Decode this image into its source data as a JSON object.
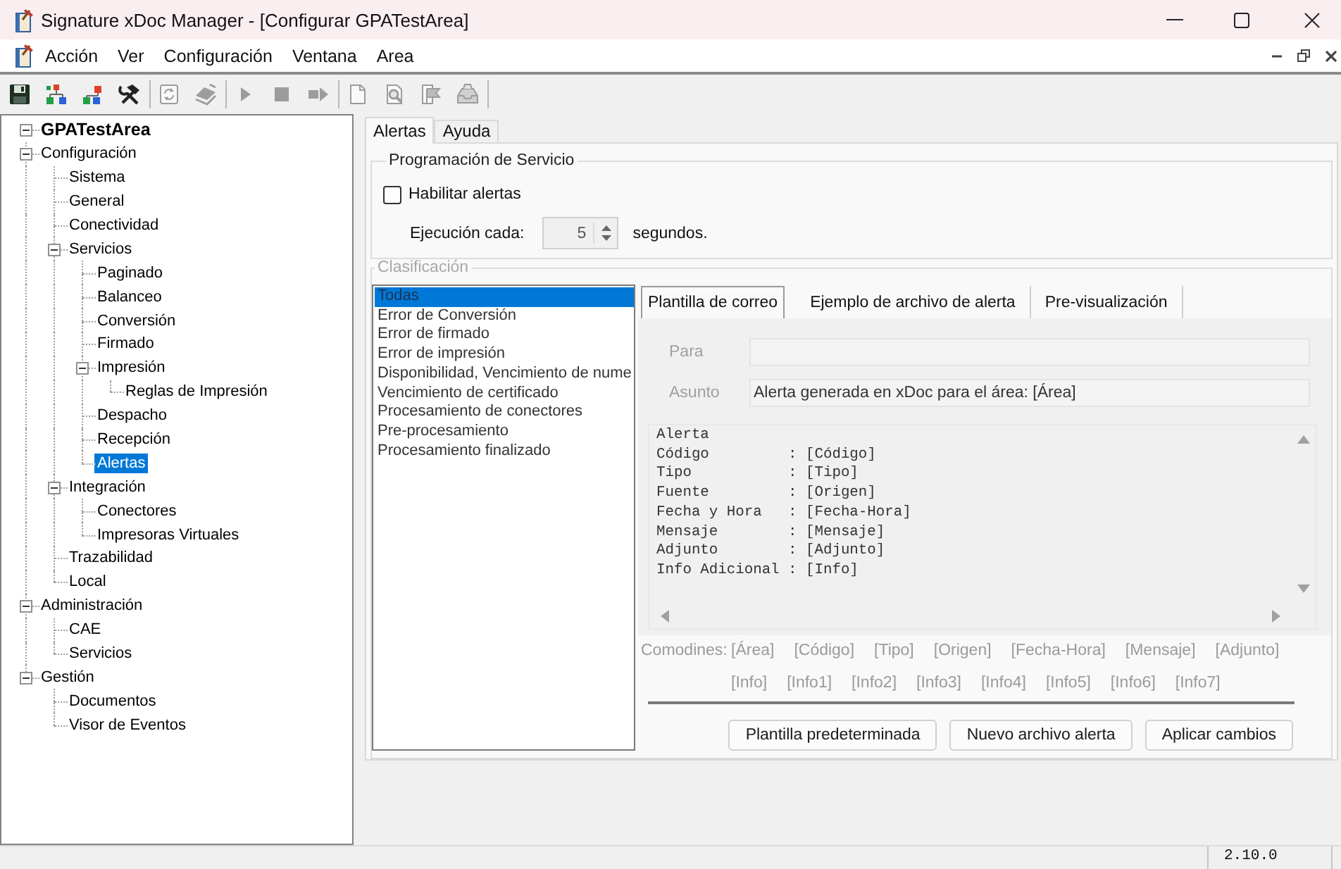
{
  "window": {
    "title": "Signature xDoc Manager - [Configurar GPATestArea]"
  },
  "menu": [
    {
      "label": "Acción"
    },
    {
      "label": "Ver"
    },
    {
      "label": "Configuración"
    },
    {
      "label": "Ventana"
    },
    {
      "label": "Area"
    }
  ],
  "toolbar": {
    "groups": [
      [
        {
          "disabled": false
        },
        {
          "disabled": false
        },
        {
          "disabled": false
        },
        {
          "disabled": false
        }
      ],
      [
        {
          "disabled": true
        },
        {
          "disabled": true
        }
      ],
      [
        {
          "disabled": true
        },
        {
          "disabled": true
        },
        {
          "disabled": true
        }
      ],
      [
        {
          "disabled": true
        },
        {
          "disabled": true
        },
        {
          "disabled": true
        },
        {
          "disabled": true
        }
      ]
    ]
  },
  "tree": [
    {
      "label": "GPATestArea",
      "expanded": true,
      "selected": false,
      "children": [
        {
          "label": "Configuración",
          "expanded": true,
          "selected": false,
          "children": [
            {
              "label": "Sistema",
              "selected": false
            },
            {
              "label": "General",
              "selected": false
            },
            {
              "label": "Conectividad",
              "selected": false
            },
            {
              "label": "Servicios",
              "expanded": true,
              "selected": false,
              "children": [
                {
                  "label": "Paginado",
                  "selected": false
                },
                {
                  "label": "Balanceo",
                  "selected": false
                },
                {
                  "label": "Conversión",
                  "selected": false
                },
                {
                  "label": "Firmado",
                  "selected": false
                },
                {
                  "label": "Impresión",
                  "expanded": true,
                  "selected": false,
                  "children": [
                    {
                      "label": "Reglas de Impresión",
                      "selected": false
                    }
                  ]
                },
                {
                  "label": "Despacho",
                  "selected": false
                },
                {
                  "label": "Recepción",
                  "selected": false
                },
                {
                  "label": "Alertas",
                  "selected": true
                }
              ]
            },
            {
              "label": "Integración",
              "expanded": true,
              "selected": false,
              "children": [
                {
                  "label": "Conectores",
                  "selected": false
                },
                {
                  "label": "Impresoras Virtuales",
                  "selected": false
                }
              ]
            },
            {
              "label": "Trazabilidad",
              "selected": false
            },
            {
              "label": "Local",
              "selected": false
            }
          ]
        },
        {
          "label": "Administración",
          "expanded": true,
          "selected": false,
          "children": [
            {
              "label": "CAE",
              "selected": false
            },
            {
              "label": "Servicios",
              "selected": false
            }
          ]
        },
        {
          "label": "Gestión",
          "expanded": true,
          "selected": false,
          "children": [
            {
              "label": "Documentos",
              "selected": false
            },
            {
              "label": "Visor de Eventos",
              "selected": false
            }
          ]
        }
      ]
    }
  ],
  "tabs": [
    {
      "label": "Alertas",
      "selected": true
    },
    {
      "label": "Ayuda",
      "selected": false
    }
  ],
  "service": {
    "title": "Programación de Servicio",
    "enable_alerts": {
      "label": "Habilitar alertas",
      "checked": false
    },
    "interval": {
      "label": "Ejecución cada:",
      "value": "5",
      "unit": "segundos.",
      "disabled": true
    }
  },
  "classification": {
    "title": "Clasificación",
    "disabled": true,
    "items": [
      {
        "label": "Todas",
        "selected": true
      },
      {
        "label": "Error de Conversión",
        "selected": false
      },
      {
        "label": "Error de firmado",
        "selected": false
      },
      {
        "label": "Error de impresión",
        "selected": false
      },
      {
        "label": "Disponibilidad, Vencimiento de nume",
        "selected": false
      },
      {
        "label": "Vencimiento de certificado",
        "selected": false
      },
      {
        "label": "Procesamiento de conectores",
        "selected": false
      },
      {
        "label": "Pre-procesamiento",
        "selected": false
      },
      {
        "label": "Procesamiento finalizado",
        "selected": false
      }
    ],
    "tabs": [
      {
        "label": "Plantilla de correo",
        "selected": true
      },
      {
        "label": "Ejemplo de archivo de alerta",
        "selected": false
      },
      {
        "label": "Pre-visualización",
        "selected": false
      }
    ],
    "to": {
      "label": "Para"
    },
    "subject": {
      "label": "Asunto",
      "value": "Alerta generada en xDoc para el área: [Área]"
    },
    "body": {
      "value": "Alerta\nCódigo         : [Código]\nTipo           : [Tipo]\nFuente         : [Origen]\nFecha y Hora   : [Fecha-Hora]\nMensaje        : [Mensaje]\nAdjunto        : [Adjunto]\nInfo Adicional : [Info]"
    },
    "wildcards": {
      "label": "Comodines:",
      "tokens": [
        "[Área]",
        "[Código]",
        "[Tipo]",
        "[Origen]",
        "[Fecha-Hora]",
        "[Mensaje]",
        "[Adjunto]",
        "[Info]",
        "[Info1]",
        "[Info2]",
        "[Info3]",
        "[Info4]",
        "[Info5]",
        "[Info6]",
        "[Info7]"
      ]
    },
    "buttons": [
      {
        "label": "Plantilla predeterminada"
      },
      {
        "label": "Nuevo archivo alerta"
      },
      {
        "label": "Aplicar cambios"
      }
    ]
  },
  "status_bar": {
    "version": "2.10.0"
  }
}
